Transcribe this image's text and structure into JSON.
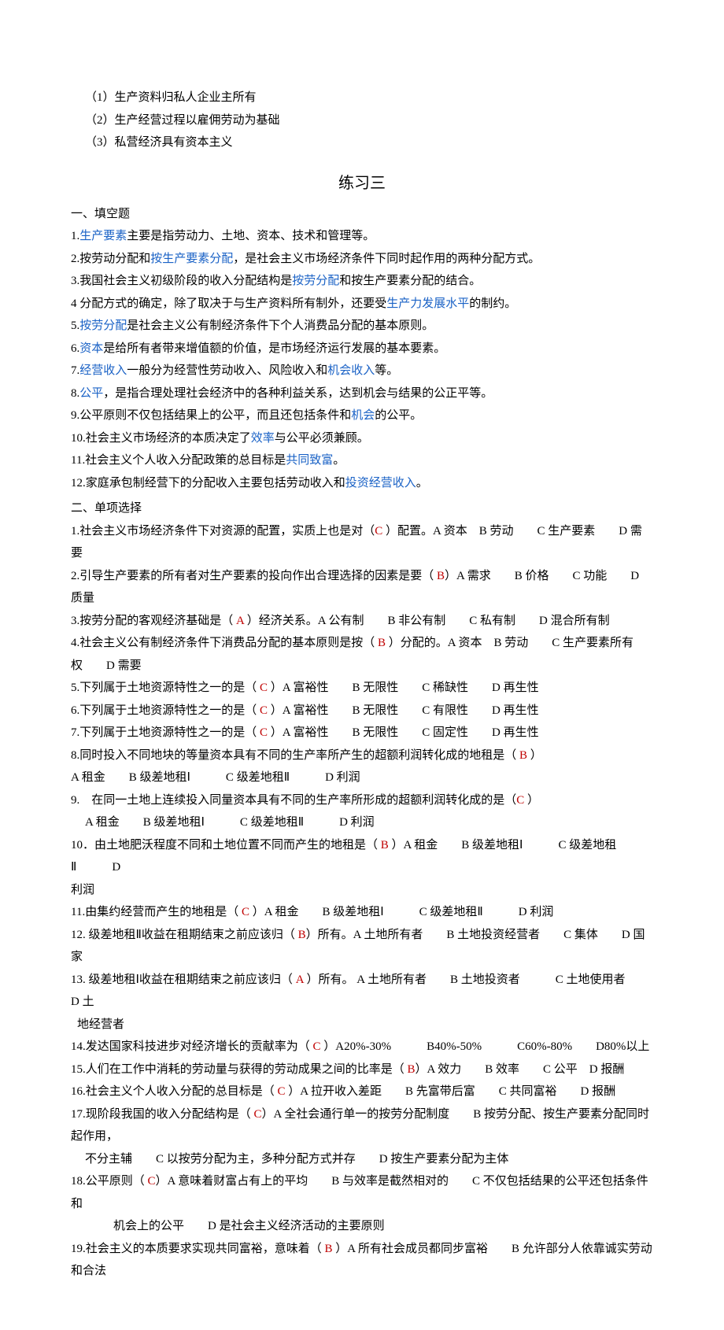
{
  "pre": {
    "l1": "（1）生产资料归私人企业主所有",
    "l2": "（2）生产经营过程以雇佣劳动为基础",
    "l3": "（3）私营经济具有资本主义"
  },
  "title": "练习三",
  "sec1": {
    "head": "一、填空题",
    "f1a": "1.",
    "f1b": "生产要素",
    "f1c": "主要是指劳动力、土地、资本、技术和管理等。",
    "f2a": "2.按劳动分配和",
    "f2b": "按生产要素分配",
    "f2c": "，是社会主义市场经济条件下同时起作用的两种分配方式。",
    "f3a": "3.我国社会主义初级阶段的收入分配结构是",
    "f3b": "按劳分配",
    "f3c": "和按生产要素分配的结合。",
    "f4a": "4 分配方式的确定，除了取决于与生产资料所有制外，还要受",
    "f4b": "生产力发展水平",
    "f4c": "的制约。",
    "f5a": "5.",
    "f5b": "按劳分配",
    "f5c": "是社会主义公有制经济条件下个人消费品分配的基本原则。",
    "f6a": "6.",
    "f6b": "资本",
    "f6c": "是给所有者带来增值额的价值，是市场经济运行发展的基本要素。",
    "f7a": "7.",
    "f7b": "经营收入",
    "f7c": "一般分为经营性劳动收入、风险收入和",
    "f7d": "机会收入",
    "f7e": "等。",
    "f8a": "8.",
    "f8b": "公平",
    "f8c": "，是指合理处理社会经济中的各种利益关系，达到机会与结果的公正平等。",
    "f9a": "9.公平原则不仅包括结果上的公平，而且还包括条件和",
    "f9b": "机会",
    "f9c": "的公平。",
    "f10a": "10.社会主义市场经济的本质决定了",
    "f10b": "效率",
    "f10c": "与公平必须兼顾。",
    "f11a": "11.社会主义个人收入分配政策的总目标是",
    "f11b": "共同致富",
    "f11c": "。",
    "f12a": "12.家庭承包制经营下的分配收入主要包括劳动收入和",
    "f12b": "投资经营收入",
    "f12c": "。"
  },
  "sec2": {
    "head": "二、单项选择",
    "q1a": "1.社会主义市场经济条件下对资源的配置，实质上也是对（",
    "q1ans": "C",
    "q1b": " ）配置。A 资本 B 劳动  C 生产要素  D 需要",
    "q2a": "2.引导生产要素的所有者对生产要素的投向作出合理选择的因素是要（ ",
    "q2ans": "B",
    "q2b": "）A 需求  B 价格  C 功能  D 质量",
    "q3a": "3.按劳分配的客观经济基础是（ ",
    "q3ans": "A",
    "q3b": " ）经济关系。A 公有制  B 非公有制  C 私有制  D 混合所有制",
    "q4a": "4.社会主义公有制经济条件下消费品分配的基本原则是按（ ",
    "q4ans": "B",
    "q4b": " ）分配的。A 资本 B 劳动  C 生产要素所有权  D 需要",
    "q5a": "5.下列属于土地资源特性之一的是（ ",
    "q5ans": "C",
    "q5b": " ）A 富裕性  B 无限性  C 稀缺性  D 再生性",
    "q6a": "6.下列属于土地资源特性之一的是（ ",
    "q6ans": "C",
    "q6b": " ）A 富裕性  B 无限性  C 有限性  D 再生性",
    "q7a": "7.下列属于土地资源特性之一的是（ ",
    "q7ans": "C",
    "q7b": " ）A 富裕性  B 无限性  C 固定性  D 再生性",
    "q8a": "8.同时投入不同地块的等量资本具有不同的生产率所产生的超额利润转化成的地租是（ ",
    "q8ans": "B",
    "q8b": " ）",
    "q8opts": " A 租金  B 级差地租Ⅰ   C 级差地租Ⅱ   D 利润",
    "q9a": "9. 在同一土地上连续投入同量资本具有不同的生产率所形成的超额利润转化成的是（",
    "q9ans": "C",
    "q9b": " ）",
    "q9opts": "A 租金  B 级差地租Ⅰ   C 级差地租Ⅱ   D 利润",
    "q10a": "10．由土地肥沃程度不同和土地位置不同而产生的地租是（ ",
    "q10ans": "B",
    "q10b": " ）A 租金  B 级差地租Ⅰ   C 级差地租Ⅱ   D",
    "q10c": "利润",
    "q11a": "11.由集约经营而产生的地租是（ ",
    "q11ans": "C",
    "q11b": " ）A 租金  B 级差地租Ⅰ   C 级差地租Ⅱ   D 利润",
    "q12a": "12. 级差地租Ⅱ收益在租期结束之前应该归（ ",
    "q12ans": "B",
    "q12b": "）所有。A 土地所有者  B 土地投资经营者  C 集体  D 国家",
    "q13a": "13. 级差地租Ⅰ收益在租期结束之前应该归（ ",
    "q13ans": "A",
    "q13b": " ）所有。 A 土地所有者  B 土地投资者   C 土地使用者  D 土",
    "q13c": "地经营者",
    "q14a": "14.发达国家科技进步对经济增长的贡献率为（ ",
    "q14ans": "C",
    "q14b": " ）A20%-30%   B40%-50%   C60%-80%  D80%以上",
    "q15a": "15.人们在工作中消耗的劳动量与获得的劳动成果之间的比率是（ ",
    "q15ans": "B",
    "q15b": "）A 效力  B 效率  C 公平 D 报酬",
    "q16a": "16.社会主义个人收入分配的总目标是（ ",
    "q16ans": "C",
    "q16b": " ）A 拉开收入差距  B 先富带后富  C 共同富裕  D 报酬",
    "q17a": "17.现阶段我国的收入分配结构是（ ",
    "q17ans": "C",
    "q17b": "）A 全社会通行单一的按劳分配制度  B 按劳分配、按生产要素分配同时起作用，",
    "q17c": "不分主辅  C 以按劳分配为主，多种分配方式并存  D 按生产要素分配为主体",
    "q18a": "18.公平原则（ ",
    "q18ans": "C",
    "q18b": "）A 意味着财富占有上的平均  B 与效率是截然相对的  C 不仅包括结果的公平还包括条件和",
    "q18c": "机会上的公平  D 是社会主义经济活动的主要原则",
    "q19a": "19.社会主义的本质要求实现共同富裕，意味着（ ",
    "q19ans": "B",
    "q19b": " ）A 所有社会成员都同步富裕  B 允许部分人依靠诚实劳动和合法"
  }
}
